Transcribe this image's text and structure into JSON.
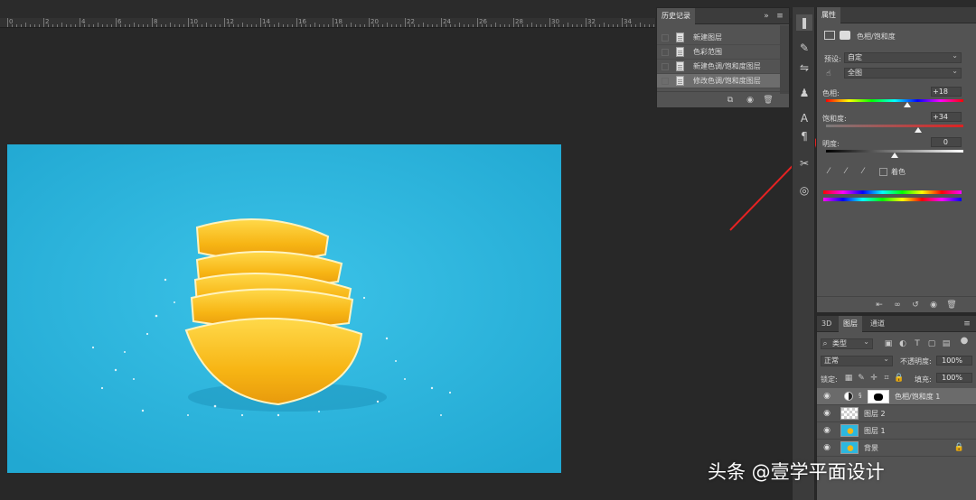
{
  "ruler": {
    "numbers": [
      "0",
      "2",
      "4",
      "6",
      "8",
      "10",
      "12",
      "14",
      "16",
      "18",
      "20",
      "22",
      "24",
      "26",
      "28",
      "30",
      "32",
      "34",
      "36"
    ]
  },
  "history": {
    "tab": "历史记录",
    "collapse": "»",
    "menu": "≡",
    "items": [
      {
        "label": "新建图层",
        "selected": false
      },
      {
        "label": "色彩范围",
        "selected": false
      },
      {
        "label": "新建色调/饱和度图层",
        "selected": false
      },
      {
        "label": "修改色调/饱和度图层",
        "selected": true
      }
    ]
  },
  "properties": {
    "tab": "属性",
    "header": "色相/饱和度",
    "preset_label": "预设:",
    "preset_value": "自定",
    "channel_value": "全图",
    "hue_label": "色相:",
    "hue_value": "+18",
    "hue_level": 0.59,
    "saturation_label": "饱和度:",
    "saturation_value": "+34",
    "saturation_level": 0.67,
    "lightness_label": "明度:",
    "lightness_value": "0",
    "lightness_level": 0.5,
    "colorize_label": "着色"
  },
  "layers": {
    "tabs": [
      "3D",
      "图层",
      "通道"
    ],
    "filter_value": "类型",
    "blend_mode": "正常",
    "opacity_label": "不透明度:",
    "opacity_value": "100%",
    "lock_label": "锁定:",
    "fill_label": "填充:",
    "fill_value": "100%",
    "rows": [
      {
        "name": "色相/饱和度 1",
        "kind": "adjustment",
        "selected": true
      },
      {
        "name": "图层 2",
        "kind": "transparent",
        "selected": false
      },
      {
        "name": "图层 1",
        "kind": "image",
        "selected": false
      },
      {
        "name": "背景",
        "kind": "image",
        "selected": false
      }
    ]
  },
  "watermark": "头条 @壹学平面设计",
  "colors": {
    "accent_arrow": "#e52222",
    "canvas_bg": "#2cb7df",
    "lemon": "#f7b514"
  }
}
